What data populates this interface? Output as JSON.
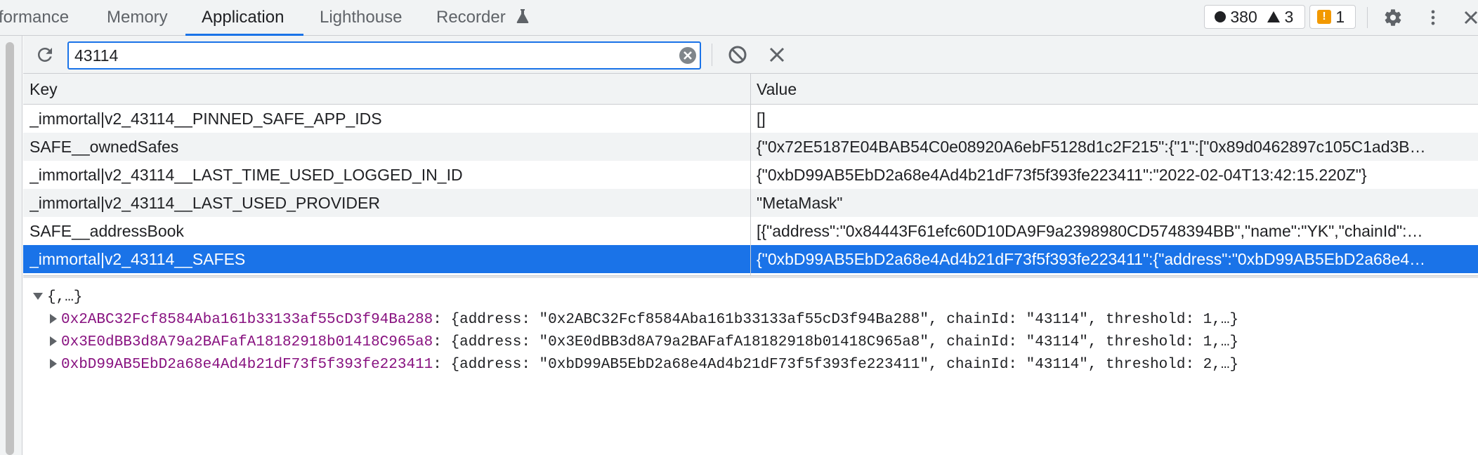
{
  "tabs": [
    {
      "label": "formance"
    },
    {
      "label": "Memory"
    },
    {
      "label": "Application"
    },
    {
      "label": "Lighthouse"
    },
    {
      "label": "Recorder"
    }
  ],
  "status": {
    "errors": "380",
    "warnings": "3",
    "issues": "1"
  },
  "filter": {
    "value": "43114"
  },
  "table": {
    "headers": {
      "key": "Key",
      "value": "Value"
    },
    "rows": [
      {
        "key": "_immortal|v2_43114__PINNED_SAFE_APP_IDS",
        "value": "[]"
      },
      {
        "key": "SAFE__ownedSafes",
        "value": "{\"0x72E5187E04BAB54C0e08920A6ebF5128d1c2F215\":{\"1\":[\"0x89d0462897c105C1ad3B…"
      },
      {
        "key": "_immortal|v2_43114__LAST_TIME_USED_LOGGED_IN_ID",
        "value": "{\"0xbD99AB5EbD2a68e4Ad4b21dF73f5f393fe223411\":\"2022-02-04T13:42:15.220Z\"}"
      },
      {
        "key": "_immortal|v2_43114__LAST_USED_PROVIDER",
        "value": "\"MetaMask\""
      },
      {
        "key": "SAFE__addressBook",
        "value": "[{\"address\":\"0x84443F61efc60D10DA9F9a2398980CD5748394BB\",\"name\":\"YK\",\"chainId\":…"
      },
      {
        "key": "_immortal|v2_43114__SAFES",
        "value": "{\"0xbD99AB5EbD2a68e4Ad4b21dF73f5f393fe223411\":{\"address\":\"0xbD99AB5EbD2a68e4…"
      }
    ]
  },
  "preview": {
    "root": "{,…}",
    "items": [
      {
        "key": "0x2ABC32Fcf8584Aba161b33133af55cD3f94Ba288",
        "summary": ": {address: \"0x2ABC32Fcf8584Aba161b33133af55cD3f94Ba288\", chainId: \"43114\", threshold: 1,…}"
      },
      {
        "key": "0x3E0dBB3d8A79a2BAFafA18182918b01418C965a8",
        "summary": ": {address: \"0x3E0dBB3d8A79a2BAFafA18182918b01418C965a8\", chainId: \"43114\", threshold: 1,…}"
      },
      {
        "key": "0xbD99AB5EbD2a68e4Ad4b21dF73f5f393fe223411",
        "summary": ": {address: \"0xbD99AB5EbD2a68e4Ad4b21dF73f5f393fe223411\", chainId: \"43114\", threshold: 2,…}"
      }
    ]
  },
  "icons": {
    "refresh": "refresh-icon",
    "clear_input": "clear-input-icon",
    "block": "block-icon",
    "delete": "delete-icon",
    "settings": "gear-icon",
    "more": "more-vertical-icon",
    "close": "close-icon",
    "experimental": "flask-icon"
  },
  "colors": {
    "accent": "#1a73e8",
    "selected_row": "#1a73e8",
    "property_key": "#881280",
    "issue_badge": "#f29900"
  }
}
